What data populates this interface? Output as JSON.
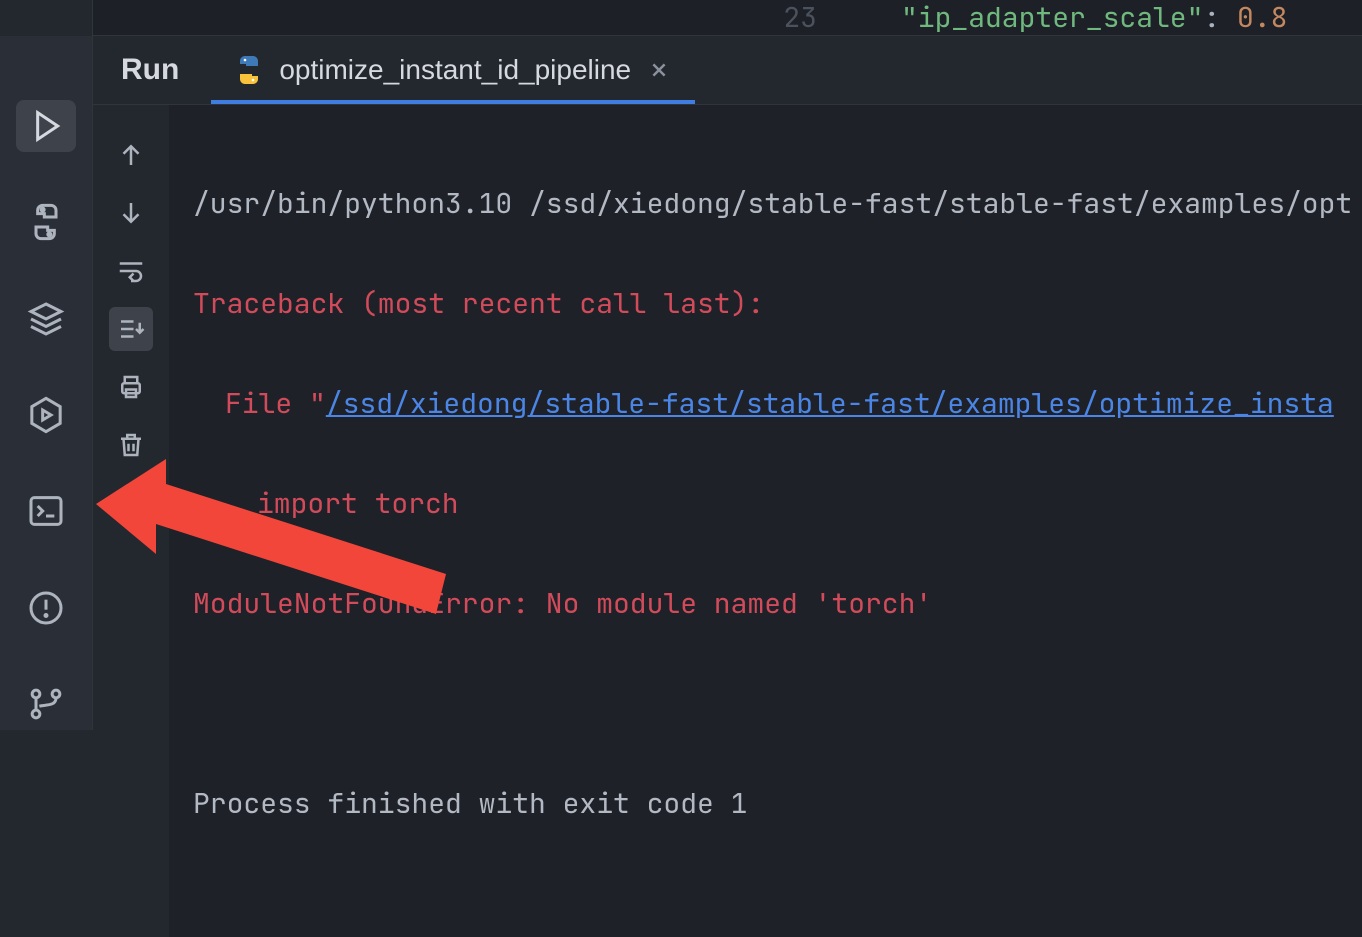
{
  "editor": {
    "line_number": "23",
    "code_key": "\"ip_adapter_scale\"",
    "code_punc": ": ",
    "code_val": "0.8"
  },
  "run": {
    "title": "Run",
    "tab_label": "optimize_instant_id_pipeline"
  },
  "console": {
    "line_cmd": "/usr/bin/python3.10 /ssd/xiedong/stable-fast/stable-fast/examples/opt",
    "line_tb": "Traceback (most recent call last):",
    "line_file_pre": "File \"",
    "line_file_link": "/ssd/xiedong/stable-fast/stable-fast/examples/optimize_insta",
    "line_import": "import torch",
    "line_err": "ModuleNotFoundError: No module named 'torch'",
    "line_exit": "Process finished with exit code 1"
  }
}
